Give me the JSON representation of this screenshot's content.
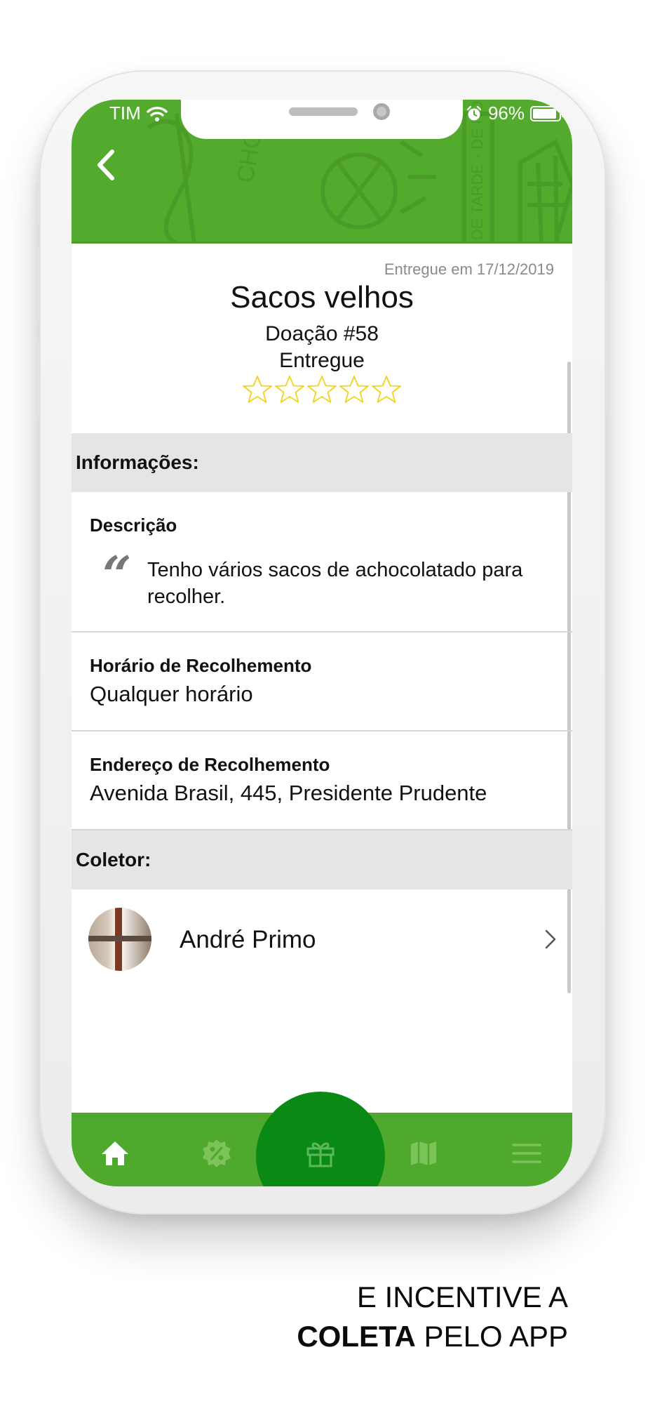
{
  "status_bar": {
    "carrier": "TIM",
    "battery": "96%"
  },
  "delivery": {
    "delivered_on": "Entregue em 17/12/2019",
    "title": "Sacos velhos",
    "donation": "Doação #58",
    "status": "Entregue",
    "rating": 0,
    "rating_max": 5
  },
  "info_section": {
    "header": "Informações:",
    "description_label": "Descrição",
    "description_text": "Tenho vários sacos de achocolatado para recolher.",
    "pickup_time_label": "Horário de Recolhemento",
    "pickup_time_value": "Qualquer horário",
    "pickup_address_label": "Endereço de Recolhemento",
    "pickup_address_value": "Avenida Brasil, 445, Presidente Prudente"
  },
  "collector_section": {
    "header": "Coletor:",
    "name": "André Primo"
  },
  "tabbar": {
    "tabs": [
      {
        "icon": "home-icon",
        "active": true
      },
      {
        "icon": "discount-badge-icon",
        "active": false
      },
      {
        "icon": "gift-icon",
        "active": false,
        "center": true
      },
      {
        "icon": "map-icon",
        "active": false
      },
      {
        "icon": "menu-icon",
        "active": false
      }
    ]
  },
  "caption": {
    "line1": "E INCENTIVE A",
    "line2_bold": "COLETA",
    "line2_rest": " PELO APP"
  },
  "colors": {
    "brand_green": "#52ab2c",
    "tab_center": "#0a8a14",
    "star": "#f2d31a"
  }
}
